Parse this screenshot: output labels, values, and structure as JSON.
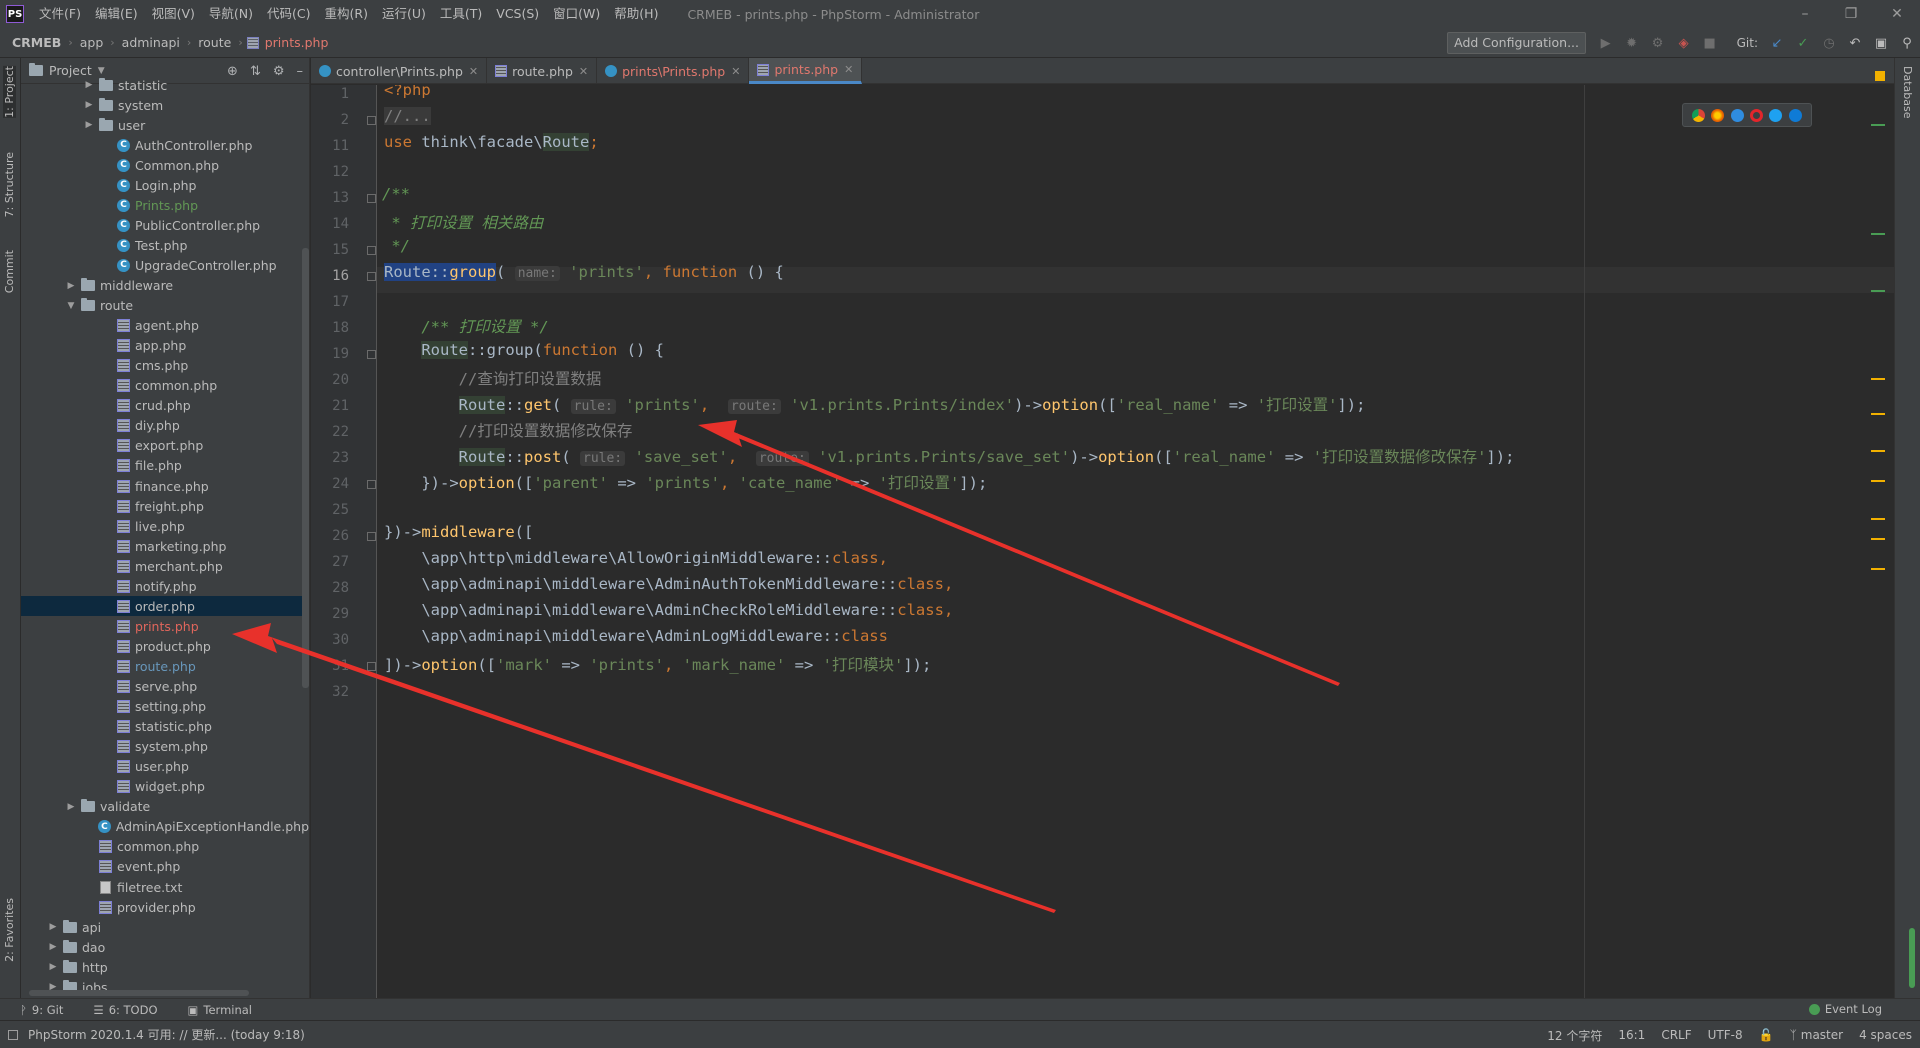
{
  "menu": [
    "文件(F)",
    "编辑(E)",
    "视图(V)",
    "导航(N)",
    "代码(C)",
    "重构(R)",
    "运行(U)",
    "工具(T)",
    "VCS(S)",
    "窗口(W)",
    "帮助(H)"
  ],
  "window_title": "CRMEB - prints.php - PhpStorm - Administrator",
  "breadcrumbs": [
    "CRMEB",
    "app",
    "adminapi",
    "route",
    "prints.php"
  ],
  "add_configuration": "Add Configuration...",
  "git_label": "Git:",
  "left_tabs": [
    "1: Project",
    "7: Structure",
    "Commit",
    "2: Favorites"
  ],
  "right_tabs": [
    "Database"
  ],
  "project_panel": {
    "title": "Project",
    "tree": [
      {
        "label": "statistic",
        "type": "folder",
        "indent": 4,
        "arrow": "right",
        "style": ""
      },
      {
        "label": "system",
        "type": "folder",
        "indent": 4,
        "arrow": "right",
        "style": ""
      },
      {
        "label": "user",
        "type": "folder",
        "indent": 4,
        "arrow": "right",
        "style": ""
      },
      {
        "label": "AuthController.php",
        "type": "class",
        "indent": 5,
        "arrow": "",
        "style": ""
      },
      {
        "label": "Common.php",
        "type": "class",
        "indent": 5,
        "arrow": "",
        "style": ""
      },
      {
        "label": "Login.php",
        "type": "class",
        "indent": 5,
        "arrow": "",
        "style": ""
      },
      {
        "label": "Prints.php",
        "type": "class",
        "indent": 5,
        "arrow": "",
        "style": "green"
      },
      {
        "label": "PublicController.php",
        "type": "class",
        "indent": 5,
        "arrow": "",
        "style": ""
      },
      {
        "label": "Test.php",
        "type": "class",
        "indent": 5,
        "arrow": "",
        "style": ""
      },
      {
        "label": "UpgradeController.php",
        "type": "class",
        "indent": 5,
        "arrow": "",
        "style": ""
      },
      {
        "label": "middleware",
        "type": "folder",
        "indent": 3,
        "arrow": "right",
        "style": ""
      },
      {
        "label": "route",
        "type": "folder",
        "indent": 3,
        "arrow": "down",
        "style": ""
      },
      {
        "label": "agent.php",
        "type": "php",
        "indent": 5,
        "arrow": "",
        "style": ""
      },
      {
        "label": "app.php",
        "type": "php",
        "indent": 5,
        "arrow": "",
        "style": ""
      },
      {
        "label": "cms.php",
        "type": "php",
        "indent": 5,
        "arrow": "",
        "style": ""
      },
      {
        "label": "common.php",
        "type": "php",
        "indent": 5,
        "arrow": "",
        "style": ""
      },
      {
        "label": "crud.php",
        "type": "php",
        "indent": 5,
        "arrow": "",
        "style": ""
      },
      {
        "label": "diy.php",
        "type": "php",
        "indent": 5,
        "arrow": "",
        "style": ""
      },
      {
        "label": "export.php",
        "type": "php",
        "indent": 5,
        "arrow": "",
        "style": ""
      },
      {
        "label": "file.php",
        "type": "php",
        "indent": 5,
        "arrow": "",
        "style": ""
      },
      {
        "label": "finance.php",
        "type": "php",
        "indent": 5,
        "arrow": "",
        "style": ""
      },
      {
        "label": "freight.php",
        "type": "php",
        "indent": 5,
        "arrow": "",
        "style": ""
      },
      {
        "label": "live.php",
        "type": "php",
        "indent": 5,
        "arrow": "",
        "style": ""
      },
      {
        "label": "marketing.php",
        "type": "php",
        "indent": 5,
        "arrow": "",
        "style": ""
      },
      {
        "label": "merchant.php",
        "type": "php",
        "indent": 5,
        "arrow": "",
        "style": ""
      },
      {
        "label": "notify.php",
        "type": "php",
        "indent": 5,
        "arrow": "",
        "style": ""
      },
      {
        "label": "order.php",
        "type": "php",
        "indent": 5,
        "arrow": "",
        "style": "selected"
      },
      {
        "label": "prints.php",
        "type": "php",
        "indent": 5,
        "arrow": "",
        "style": "red"
      },
      {
        "label": "product.php",
        "type": "php",
        "indent": 5,
        "arrow": "",
        "style": ""
      },
      {
        "label": "route.php",
        "type": "php",
        "indent": 5,
        "arrow": "",
        "style": "blue"
      },
      {
        "label": "serve.php",
        "type": "php",
        "indent": 5,
        "arrow": "",
        "style": ""
      },
      {
        "label": "setting.php",
        "type": "php",
        "indent": 5,
        "arrow": "",
        "style": ""
      },
      {
        "label": "statistic.php",
        "type": "php",
        "indent": 5,
        "arrow": "",
        "style": ""
      },
      {
        "label": "system.php",
        "type": "php",
        "indent": 5,
        "arrow": "",
        "style": ""
      },
      {
        "label": "user.php",
        "type": "php",
        "indent": 5,
        "arrow": "",
        "style": ""
      },
      {
        "label": "widget.php",
        "type": "php",
        "indent": 5,
        "arrow": "",
        "style": ""
      },
      {
        "label": "validate",
        "type": "folder",
        "indent": 3,
        "arrow": "right",
        "style": ""
      },
      {
        "label": "AdminApiExceptionHandle.php",
        "type": "class",
        "indent": 4,
        "arrow": "",
        "style": ""
      },
      {
        "label": "common.php",
        "type": "php",
        "indent": 4,
        "arrow": "",
        "style": ""
      },
      {
        "label": "event.php",
        "type": "php",
        "indent": 4,
        "arrow": "",
        "style": ""
      },
      {
        "label": "filetree.txt",
        "type": "txt",
        "indent": 4,
        "arrow": "",
        "style": ""
      },
      {
        "label": "provider.php",
        "type": "php",
        "indent": 4,
        "arrow": "",
        "style": ""
      },
      {
        "label": "api",
        "type": "folder",
        "indent": 2,
        "arrow": "right",
        "style": ""
      },
      {
        "label": "dao",
        "type": "folder",
        "indent": 2,
        "arrow": "right",
        "style": ""
      },
      {
        "label": "http",
        "type": "folder",
        "indent": 2,
        "arrow": "right",
        "style": ""
      },
      {
        "label": "jobs",
        "type": "folder",
        "indent": 2,
        "arrow": "right",
        "style": ""
      }
    ]
  },
  "editor_tabs": [
    {
      "label": "controller\\Prints.php",
      "icon": "class",
      "color": "#bbbbbb",
      "active": false
    },
    {
      "label": "route.php",
      "icon": "php",
      "color": "#bbbbbb",
      "active": false
    },
    {
      "label": "prints\\Prints.php",
      "icon": "class",
      "color": "#e0786e",
      "active": false
    },
    {
      "label": "prints.php",
      "icon": "php",
      "color": "#e0786e",
      "active": true
    }
  ],
  "line_numbers": [
    "1",
    "2",
    "11",
    "12",
    "13",
    "14",
    "15",
    "16",
    "17",
    "18",
    "19",
    "20",
    "21",
    "22",
    "23",
    "24",
    "25",
    "26",
    "27",
    "28",
    "29",
    "30",
    "31",
    "32"
  ],
  "current_line": "16",
  "code": {
    "l1": "<?php",
    "l2": "//...",
    "l11_use": "use",
    "l11_ns": " think\\facade\\",
    "l11_cls": "Route",
    "l11_end": ";",
    "l13": "/**",
    "l14": " * 打印设置 相关路由",
    "l15": " */",
    "route": "Route",
    "dc": "::",
    "group": "group",
    "get": "get",
    "post": "post",
    "option": "option",
    "middleware": "middleware",
    "function": "function",
    "class_kw": "class",
    "hint_name": "name:",
    "hint_rule": "rule:",
    "hint_route": "route:",
    "s_prints": "'prints'",
    "s_v1_index": "'v1.prints.Prints/index'",
    "s_save_set": "'save_set'",
    "s_v1_save": "'v1.prints.Prints/save_set'",
    "s_real_name": "'real_name'",
    "s_print_settings": "'打印设置'",
    "s_save_modify": "'打印设置数据修改保存'",
    "s_parent": "'parent'",
    "s_cate_name": "'cate_name'",
    "s_mark": "'mark'",
    "s_mark_name": "'mark_name'",
    "s_print_module": "'打印模块'",
    "l18": "/** 打印设置 */",
    "l20": "//查询打印设置数据",
    "l22": "//打印设置数据修改保存",
    "mw1_path": "\\app\\http\\middleware\\",
    "mw1_cls": "AllowOriginMiddleware",
    "mw2_path": "\\app\\adminapi\\middleware\\",
    "mw2_cls": "AdminAuthTokenMiddleware",
    "mw3_cls": "AdminCheckRoleMiddleware",
    "mw4_cls": "AdminLogMiddleware"
  },
  "bottom_tools": [
    {
      "label": "9: Git",
      "icon": "git-branch-icon"
    },
    {
      "label": "6: TODO",
      "icon": "list-icon"
    },
    {
      "label": "Terminal",
      "icon": "terminal-icon"
    }
  ],
  "event_log": "Event Log",
  "status_message": "PhpStorm 2020.1.4 可用: // 更新... (today 9:18)",
  "status": {
    "chars": "12 个字符",
    "position": "16:1",
    "line_sep": "CRLF",
    "encoding": "UTF-8",
    "branch": "master",
    "indent": "4 spaces"
  },
  "colors": {
    "arrow": "#e8312b",
    "selection": "#0d293e",
    "accent": "#4a88c7"
  }
}
